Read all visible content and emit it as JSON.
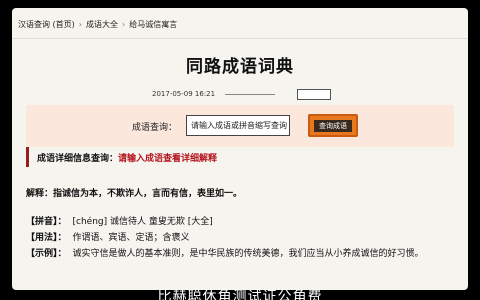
{
  "breadcrumb": [
    "汉语查询 (首页)",
    "成语大全",
    "给马诚信寓言"
  ],
  "page": {
    "title": "同路成语词典"
  },
  "meta": {
    "date": "2017-05-09 16:21"
  },
  "search": {
    "label": "成语查询：",
    "value": "请输入成语或拼音缩写查询",
    "button_label": "查询成语"
  },
  "notice": {
    "label": "成语详细信息查询：",
    "prefix": "",
    "highlight": "请输入成语查看详细解释"
  },
  "definition": "解释：指诚信为本，不欺诈人，言而有信，表里如一。",
  "details": [
    {
      "key": "【拼音】：",
      "value": "[chéng] 诚信待人 童叟无欺 [大全]"
    },
    {
      "key": "【用法】：",
      "value": "作谓语、宾语、定语；含褒义"
    },
    {
      "key": "【示例】：",
      "value": "诚实守信是做人的基本准则，是中华民族的传统美德，我们应当从小养成诚信的好习惯。"
    }
  ],
  "subtitle": "比赫聪休角测试证公角费"
}
